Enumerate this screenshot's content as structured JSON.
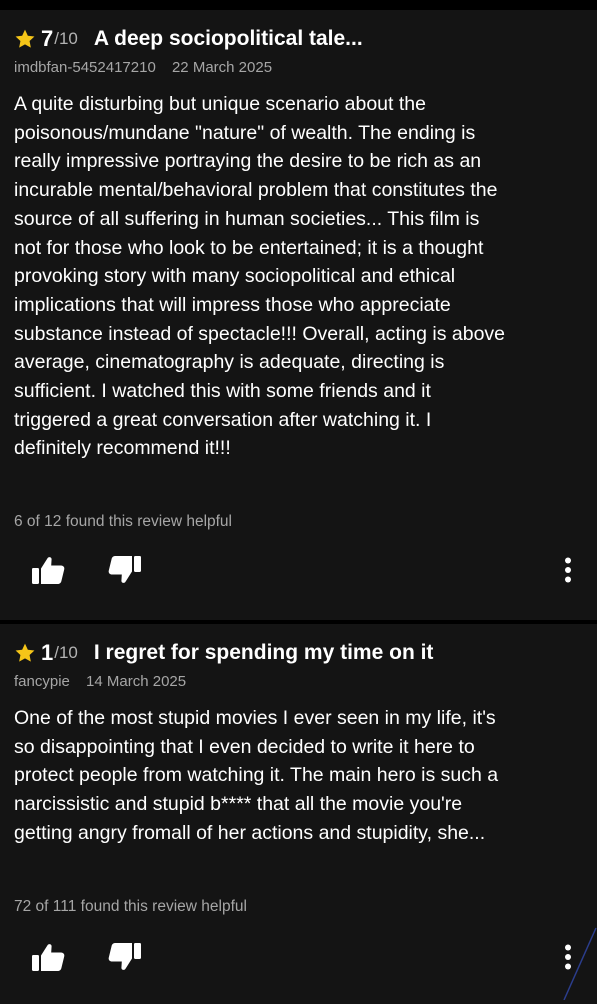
{
  "colors": {
    "background": "#000000",
    "card": "#141414",
    "accent_star": "#f5c518",
    "text_primary": "#ffffff",
    "text_secondary": "#a6a6a6",
    "scroll_mark": "#2b3d8c"
  },
  "icons": {
    "rating": "star-icon",
    "upvote": "thumbs-up-icon",
    "downvote": "thumbs-down-icon",
    "more": "more-vertical-icon"
  },
  "reviews": [
    {
      "rating": "7",
      "scale": "/10",
      "title": "A deep sociopolitical tale...",
      "author": "imdbfan-5452417210",
      "date": "22 March 2025",
      "body": [
        "A quite disturbing but unique scenario about the",
        "poisonous/mundane \"nature\" of wealth. The ending is",
        "really impressive portraying the desire to be rich as an",
        "incurable mental/behavioral problem that constitutes the",
        "source of all suffering in human societies... This film is",
        "not for those who look to be entertained; it is a thought",
        "provoking story with many sociopolitical and ethical",
        "implications that will impress those who appreciate",
        "substance instead of spectacle!!! Overall, acting is above",
        "average, cinematography is adequate, directing is",
        "sufficient. I watched this with some friends and it",
        "triggered a great conversation after watching it. I",
        "definitely recommend it!!!"
      ],
      "helpful": "6 of 12 found this review helpful"
    },
    {
      "rating": "1",
      "scale": "/10",
      "title": "I regret for spending my time on it",
      "author": "fancypie",
      "date": "14 March 2025",
      "body": [
        "One of the most stupid movies I ever seen in my life, it's",
        "so disappointing that I even decided to write it here to",
        "protect people from watching it. The main hero is such a",
        "narcissistic and stupid b**** that all the movie you're",
        "getting angry fromall of her actions and stupidity, she..."
      ],
      "helpful": "72 of 111 found this review helpful"
    }
  ]
}
